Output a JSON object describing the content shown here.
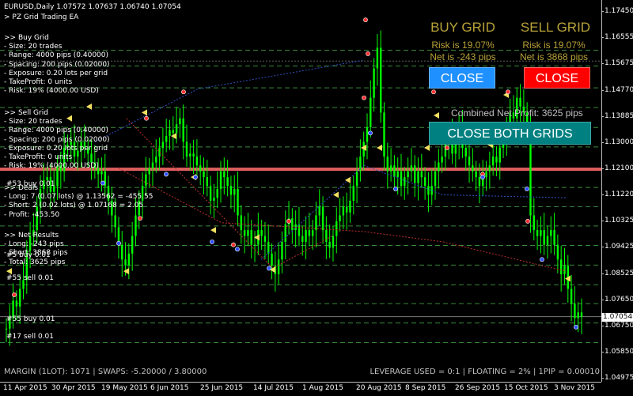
{
  "header": {
    "symbol_info": "EURUSD,Daily  1.07572 1.07637 1.06740 1.07054",
    "ea_name": "PZ Grid Trading EA"
  },
  "buy_grid_panel": {
    "lines": [
      ">> Buy Grid",
      "- Size: 20 trades",
      "- Range: 4000 pips (0.40000)",
      "- Spacing:  200 pips (0.02000)",
      "- Exposure: 0.20 lots per grid",
      "- TakeProfit: 0 units",
      "- Risk: 19% (4000.00 USD)"
    ]
  },
  "sell_grid_panel": {
    "lines": [
      ">> Sell Grid",
      "- Size: 20 trades",
      "- Range: 4000 pips (0.40000)",
      "- Spacing:  200 pips (0.02000)",
      "- Exposure: 0.20 lots per grid",
      "- TakeProfit: 0 units",
      "- Risk: 19% (4000.00 USD)"
    ]
  },
  "deals_panel": {
    "lines": [
      ">> Deals",
      "- Long: 7  (0.07 lots) @  1.13562 = -455.55",
      "- Short: 2  (0.02 lots) @  1.07168 = 2.05",
      "- Profit: -453.50"
    ]
  },
  "net_results_panel": {
    "lines": [
      ">> Net Results",
      "- Long: -243 pips",
      "- Short: 3868 pips",
      "- Total: 3625 pips"
    ]
  },
  "chart_labels": [
    {
      "text": "#53 buy 0.01"
    },
    {
      "text": "#55 sell 0.01"
    },
    {
      "text": "#55 buy 0.01"
    },
    {
      "text": "#17 sell 0.01"
    },
    {
      "text": "#5 buy 0.01"
    }
  ],
  "buy_grid": {
    "title": "BUY GRID",
    "risk": "Risk is 19.07%",
    "net": "Net is -243 pips",
    "close_label": "CLOSE"
  },
  "sell_grid": {
    "title": "SELL GRID",
    "risk": "Risk is 19.07%",
    "net": "Net is 3868 pips",
    "close_label": "CLOSE"
  },
  "combined_profit": "Combined Net Profit: 3625 pips",
  "close_both_label": "CLOSE BOTH GRIDS",
  "status_left": "MARGIN (1LOT): 1071 | SWAPS: -5.20000 / 3.80000",
  "status_right": "LEVERAGE USED = 0:1 | FLOATING = 2% | 1PIP = 0.00010",
  "current_price": "1.07054",
  "colors": {
    "background": "#000000",
    "candle": "#00ff00",
    "grid_line": "#3a8a3a",
    "risk_line": "#e06060",
    "title_gold": "#b8a238",
    "buy_button": "#1e90ff",
    "sell_button": "#ff0000",
    "both_button": "#008080"
  },
  "chart_data": {
    "type": "candlestick",
    "symbol": "EURUSD",
    "timeframe": "Daily",
    "ylim": [
      1.0475,
      1.1775
    ],
    "y_ticks": [
      "1.17450",
      "1.16555",
      "1.15675",
      "1.14770",
      "1.13885",
      "1.13000",
      "1.12100",
      "1.11220",
      "1.10325",
      "1.09425",
      "1.08525",
      "1.07650",
      "1.06750",
      "1.05850",
      "1.04975"
    ],
    "x_ticks": [
      "11 Apr 2015",
      "30 Apr 2015",
      "19 May 2015",
      "6 Jun 2015",
      "25 Jun 2015",
      "14 Jul 2015",
      "1 Aug 2015",
      "20 Aug 2015",
      "8 Sep 2015",
      "26 Sep 2015",
      "15 Oct 2015",
      "3 Nov 2015"
    ],
    "dashed_levels": [
      1.1612,
      1.1558,
      1.1484,
      1.1417,
      1.1349,
      1.1283,
      1.1145,
      1.108,
      1.1014,
      1.0948,
      1.0881,
      1.0814,
      1.075,
      1.0684,
      1.0617
    ],
    "risk_level": 1.1207,
    "last_price": 1.07054,
    "closes": [
      1.0665,
      1.07,
      1.076,
      1.074,
      1.08,
      1.083,
      1.093,
      1.098,
      1.1,
      1.108,
      1.114,
      1.117,
      1.118,
      1.113,
      1.115,
      1.122,
      1.12,
      1.128,
      1.129,
      1.13,
      1.125,
      1.127,
      1.13,
      1.128,
      1.126,
      1.123,
      1.121,
      1.119,
      1.12,
      1.115,
      1.11,
      1.105,
      1.101,
      1.095,
      1.09,
      1.088,
      1.092,
      1.098,
      1.105,
      1.11,
      1.115,
      1.119,
      1.121,
      1.123,
      1.125,
      1.128,
      1.13,
      1.132,
      1.134,
      1.133,
      1.136,
      1.138,
      1.13,
      1.125,
      1.126,
      1.125,
      1.122,
      1.12,
      1.118,
      1.115,
      1.11,
      1.111,
      1.114,
      1.12,
      1.118,
      1.115,
      1.112,
      1.114,
      1.105,
      1.1,
      1.098,
      1.1,
      1.095,
      1.095,
      1.1,
      1.098,
      1.096,
      1.092,
      1.088,
      1.085,
      1.09,
      1.096,
      1.102,
      1.104,
      1.1,
      1.102,
      1.098,
      1.096,
      1.1,
      1.098,
      1.1,
      1.105,
      1.108,
      1.1,
      1.096,
      1.094,
      1.098,
      1.103,
      1.105,
      1.108,
      1.106,
      1.11,
      1.115,
      1.12,
      1.125,
      1.13,
      1.135,
      1.145,
      1.155,
      1.162,
      1.14,
      1.125,
      1.12,
      1.122,
      1.118,
      1.12,
      1.115,
      1.118,
      1.12,
      1.122,
      1.116,
      1.12,
      1.118,
      1.115,
      1.112,
      1.115,
      1.12,
      1.123,
      1.125,
      1.13,
      1.132,
      1.126,
      1.13,
      1.135,
      1.128,
      1.125,
      1.122,
      1.12,
      1.118,
      1.115,
      1.118,
      1.12,
      1.122,
      1.125,
      1.123,
      1.128,
      1.13,
      1.135,
      1.14,
      1.138,
      1.145,
      1.142,
      1.14,
      1.135,
      1.105,
      1.1,
      1.098,
      1.1,
      1.095,
      1.098,
      1.1,
      1.095,
      1.09,
      1.085,
      1.088,
      1.08,
      1.075,
      1.07,
      1.072,
      1.0705
    ]
  }
}
